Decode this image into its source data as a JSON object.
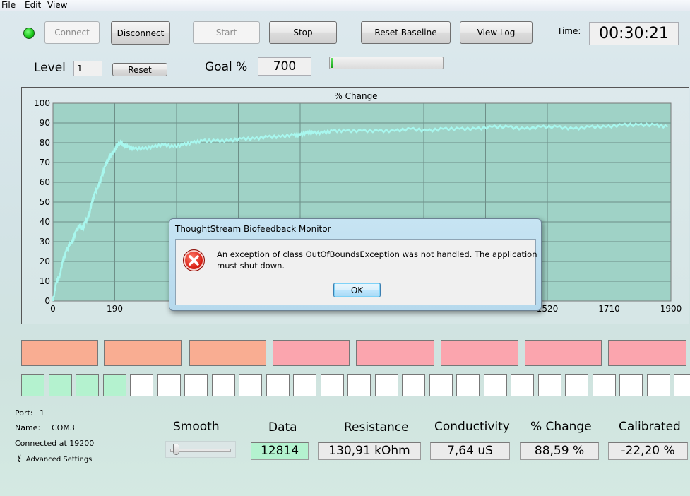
{
  "menu": [
    "File",
    "Edit",
    "View"
  ],
  "status_indicator": {
    "color": "#17c417"
  },
  "toolbar": {
    "connect": "Connect",
    "disconnect": "Disconnect",
    "start": "Start",
    "stop": "Stop",
    "reset_baseline": "Reset Baseline",
    "view_log": "View Log",
    "time_label": "Time:",
    "time_value": "00:30:21"
  },
  "level": {
    "label": "Level",
    "value": "1",
    "reset": "Reset"
  },
  "goal": {
    "label": "Goal %",
    "value": "700",
    "progress": 0.02
  },
  "chart_data": {
    "type": "line",
    "title": "% Change",
    "xlabel": "",
    "ylabel": "",
    "xlim": [
      0,
      1900
    ],
    "ylim": [
      0,
      100
    ],
    "xticks": [
      0,
      190,
      380,
      570,
      760,
      950,
      1140,
      1330,
      1520,
      1710,
      1900
    ],
    "xtick_labels": [
      "0",
      "190",
      "",
      "",
      "",
      "",
      "",
      "",
      "1520",
      "1710",
      "1900"
    ],
    "yticks": [
      0,
      10,
      20,
      30,
      40,
      50,
      60,
      70,
      80,
      90,
      100
    ],
    "grid": true,
    "line_color": "#a8f7ee",
    "x": [
      0,
      10,
      20,
      30,
      40,
      50,
      60,
      70,
      80,
      90,
      100,
      110,
      120,
      130,
      140,
      150,
      160,
      170,
      180,
      190,
      200,
      210,
      220,
      230,
      250,
      280,
      310,
      340,
      370,
      400,
      430,
      460,
      500,
      540,
      580,
      620,
      660,
      700,
      740,
      760,
      780,
      800,
      830,
      860,
      900,
      950,
      1000,
      1050,
      1100,
      1150,
      1200,
      1250,
      1300,
      1350,
      1400,
      1450,
      1500,
      1550,
      1600,
      1650,
      1700,
      1750,
      1800,
      1850,
      1890
    ],
    "y": [
      0,
      9,
      12,
      20,
      25,
      28,
      30,
      35,
      38,
      36,
      40,
      43,
      50,
      55,
      58,
      63,
      68,
      71,
      74,
      76,
      79,
      80,
      78,
      78,
      77,
      77,
      78,
      79,
      78,
      79,
      80,
      81,
      81,
      81,
      82,
      82,
      83,
      83,
      84,
      84,
      85,
      85,
      85,
      86,
      86,
      86,
      86,
      86,
      87,
      86,
      87,
      87,
      87,
      88,
      88,
      87,
      88,
      88,
      87,
      88,
      88,
      89,
      89,
      89,
      88
    ]
  },
  "indicators": {
    "bars": [
      {
        "color": "#f9ad92"
      },
      {
        "color": "#f9ad92"
      },
      {
        "color": "#f9ad92"
      },
      {
        "color": "#fba5ae"
      },
      {
        "color": "#fba5ae"
      },
      {
        "color": "#fba5ae"
      },
      {
        "color": "#fba5ae"
      },
      {
        "color": "#fba5ae"
      }
    ],
    "squares_total": 25,
    "squares_lit": 4,
    "lit_color": "#b4f2cf",
    "unlit_color": "#ffffff"
  },
  "connection": {
    "port_label": "Port:",
    "port_value": "1",
    "name_label": "Name:",
    "name_value": "COM3",
    "status": "Connected at 19200",
    "advanced": "Advanced Settings"
  },
  "smooth": {
    "label": "Smooth",
    "value": 0.05
  },
  "readouts": [
    {
      "label": "Data",
      "value": "12814",
      "highlight": "#b4f2cf"
    },
    {
      "label": "Resistance",
      "value": "130,91 kOhm",
      "highlight": "#ebebeb"
    },
    {
      "label": "Conductivity",
      "value": "7,64 uS",
      "highlight": "#ebebeb"
    },
    {
      "label": "% Change",
      "value": "88,59 %",
      "highlight": "#ebebeb"
    },
    {
      "label": "Calibrated",
      "value": "-22,20 %",
      "highlight": "#ebebeb"
    }
  ],
  "dialog": {
    "title": "ThoughtStream Biofeedback Monitor",
    "icon": "error-icon",
    "message_line1": "An exception of class OutOfBoundsException was not handled.  The application",
    "message_line2": "must shut down.",
    "ok": "OK"
  }
}
